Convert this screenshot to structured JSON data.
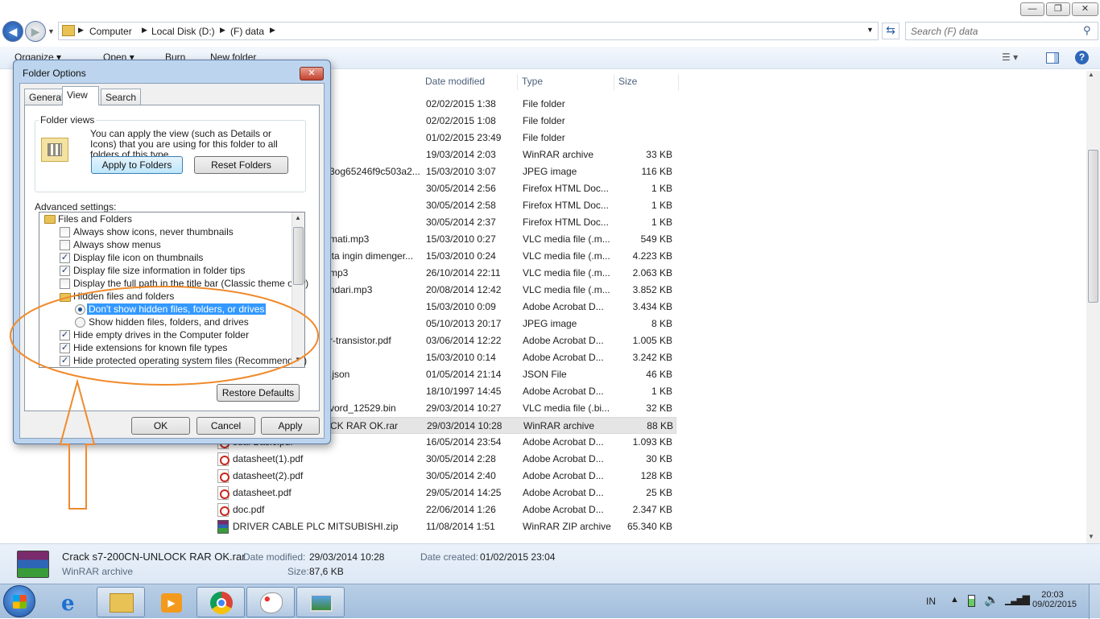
{
  "window": {
    "min_label": "—",
    "max_label": "❐",
    "close_label": "✕",
    "breadcrumb": [
      "Computer",
      "Local Disk (D:)",
      "(F) data"
    ],
    "search_placeholder": "Search (F) data"
  },
  "toolbar": {
    "organize": "Organize ▾",
    "open": "Open ▾",
    "burn": "Burn",
    "new_folder": "New folder"
  },
  "columns": {
    "date": "Date modified",
    "type": "Type",
    "size": "Size"
  },
  "files": [
    {
      "name": "",
      "date": "02/02/2015 1:38",
      "type": "File folder",
      "size": "",
      "icon": "folder"
    },
    {
      "name": "",
      "date": "02/02/2015 1:08",
      "type": "File folder",
      "size": "",
      "icon": "folder"
    },
    {
      "name": "",
      "date": "01/02/2015 23:49",
      "type": "File folder",
      "size": "",
      "icon": "folder"
    },
    {
      "name": "",
      "date": "19/03/2014 2:03",
      "type": "WinRAR archive",
      "size": "33 KB",
      "icon": "rar"
    },
    {
      "name": "3og65246f9c503a2...",
      "date": "15/03/2010 3:07",
      "type": "JPEG image",
      "size": "116 KB",
      "icon": "img"
    },
    {
      "name": "",
      "date": "30/05/2014 2:56",
      "type": "Firefox HTML Doc...",
      "size": "1 KB",
      "icon": "html"
    },
    {
      "name": "",
      "date": "30/05/2014 2:58",
      "type": "Firefox HTML Doc...",
      "size": "1 KB",
      "icon": "html"
    },
    {
      "name": "",
      "date": "30/05/2014 2:37",
      "type": "Firefox HTML Doc...",
      "size": "1 KB",
      "icon": "html"
    },
    {
      "name": "mati.mp3",
      "date": "15/03/2010 0:27",
      "type": "VLC media file (.m...",
      "size": "549 KB",
      "icon": "vlc"
    },
    {
      "name": "ita ingin dimenger...",
      "date": "15/03/2010 0:24",
      "type": "VLC media file (.m...",
      "size": "4.223 KB",
      "icon": "vlc"
    },
    {
      "name": "mp3",
      "date": "26/10/2014 22:11",
      "type": "VLC media file (.m...",
      "size": "2.063 KB",
      "icon": "vlc"
    },
    {
      "name": "ndari.mp3",
      "date": "20/08/2014 12:42",
      "type": "VLC media file (.m...",
      "size": "3.852 KB",
      "icon": "vlc"
    },
    {
      "name": "",
      "date": "15/03/2010 0:09",
      "type": "Adobe Acrobat D...",
      "size": "3.434 KB",
      "icon": "pdf"
    },
    {
      "name": "",
      "date": "05/10/2013 20:17",
      "type": "JPEG image",
      "size": "8 KB",
      "icon": "img"
    },
    {
      "name": "r-transistor.pdf",
      "date": "03/06/2014 12:22",
      "type": "Adobe Acrobat D...",
      "size": "1.005 KB",
      "icon": "pdf"
    },
    {
      "name": "",
      "date": "15/03/2010 0:14",
      "type": "Adobe Acrobat D...",
      "size": "3.242 KB",
      "icon": "pdf"
    },
    {
      "name": ".json",
      "date": "01/05/2014 21:14",
      "type": "JSON File",
      "size": "46 KB",
      "icon": "file"
    },
    {
      "name": "",
      "date": "18/10/1997 14:45",
      "type": "Adobe Acrobat D...",
      "size": "1 KB",
      "icon": "pdf"
    },
    {
      "name": "vord_12529.bin",
      "date": "29/03/2014 10:27",
      "type": "VLC media file (.bi...",
      "size": "32 KB",
      "icon": "vlc"
    },
    {
      "name": "CK RAR OK.rar",
      "date": "29/03/2014 10:28",
      "type": "WinRAR archive",
      "size": "88 KB",
      "icon": "rar",
      "selected": true
    },
    {
      "name": "sual Basic.pdf",
      "date": "16/05/2014 23:54",
      "type": "Adobe Acrobat D...",
      "size": "1.093 KB",
      "icon": "pdf"
    },
    {
      "name": "datasheet(1).pdf",
      "date": "30/05/2014 2:28",
      "type": "Adobe Acrobat D...",
      "size": "30 KB",
      "icon": "pdf"
    },
    {
      "name": "datasheet(2).pdf",
      "date": "30/05/2014 2:40",
      "type": "Adobe Acrobat D...",
      "size": "128 KB",
      "icon": "pdf"
    },
    {
      "name": "datasheet.pdf",
      "date": "29/05/2014 14:25",
      "type": "Adobe Acrobat D...",
      "size": "25 KB",
      "icon": "pdf"
    },
    {
      "name": "doc.pdf",
      "date": "22/06/2014 1:26",
      "type": "Adobe Acrobat D...",
      "size": "2.347 KB",
      "icon": "pdf"
    },
    {
      "name": "DRIVER CABLE PLC MITSUBISHI.zip",
      "date": "11/08/2014 1:51",
      "type": "WinRAR ZIP archive",
      "size": "65.340 KB",
      "icon": "rar"
    }
  ],
  "details": {
    "filename": "Crack s7-200CN-UNLOCK RAR OK.rar",
    "filetype": "WinRAR archive",
    "date_modified_label": "Date modified:",
    "date_modified": "29/03/2014 10:28",
    "date_created_label": "Date created:",
    "date_created": "01/02/2015 23:04",
    "size_label": "Size:",
    "size": "87,6 KB"
  },
  "dialog": {
    "title": "Folder Options",
    "tabs": [
      "General",
      "View",
      "Search"
    ],
    "folder_views_label": "Folder views",
    "folder_views_text": "You can apply the view (such as Details or Icons) that you are using for this folder to all folders of this type.",
    "apply_to_folders": "Apply to Folders",
    "reset_folders": "Reset Folders",
    "advanced_label": "Advanced settings:",
    "restore_defaults": "Restore Defaults",
    "ok": "OK",
    "cancel": "Cancel",
    "apply": "Apply",
    "settings": {
      "files_and_folders": "Files and Folders",
      "always_icons": "Always show icons, never thumbnails",
      "always_menus": "Always show menus",
      "display_file_icon": "Display file icon on thumbnails",
      "display_size_info": "Display file size information in folder tips",
      "display_full_path": "Display the full path in the title bar (Classic theme only)",
      "hidden_group": "Hidden files and folders",
      "dont_show_hidden": "Don't show hidden files, folders, or drives",
      "show_hidden": "Show hidden files, folders, and drives",
      "hide_empty_drives": "Hide empty drives in the Computer folder",
      "hide_extensions": "Hide extensions for known file types",
      "hide_protected": "Hide protected operating system files (Recommended)"
    },
    "checked": {
      "always_icons": false,
      "always_menus": false,
      "display_file_icon": true,
      "display_size_info": true,
      "display_full_path": false,
      "hide_empty_drives": true,
      "hide_extensions": true,
      "hide_protected": true
    }
  },
  "tray": {
    "lang": "IN",
    "time": "20:03",
    "date": "09/02/2015"
  },
  "colors": {
    "annotation": "#f08a2c",
    "selection": "#3399ff"
  }
}
